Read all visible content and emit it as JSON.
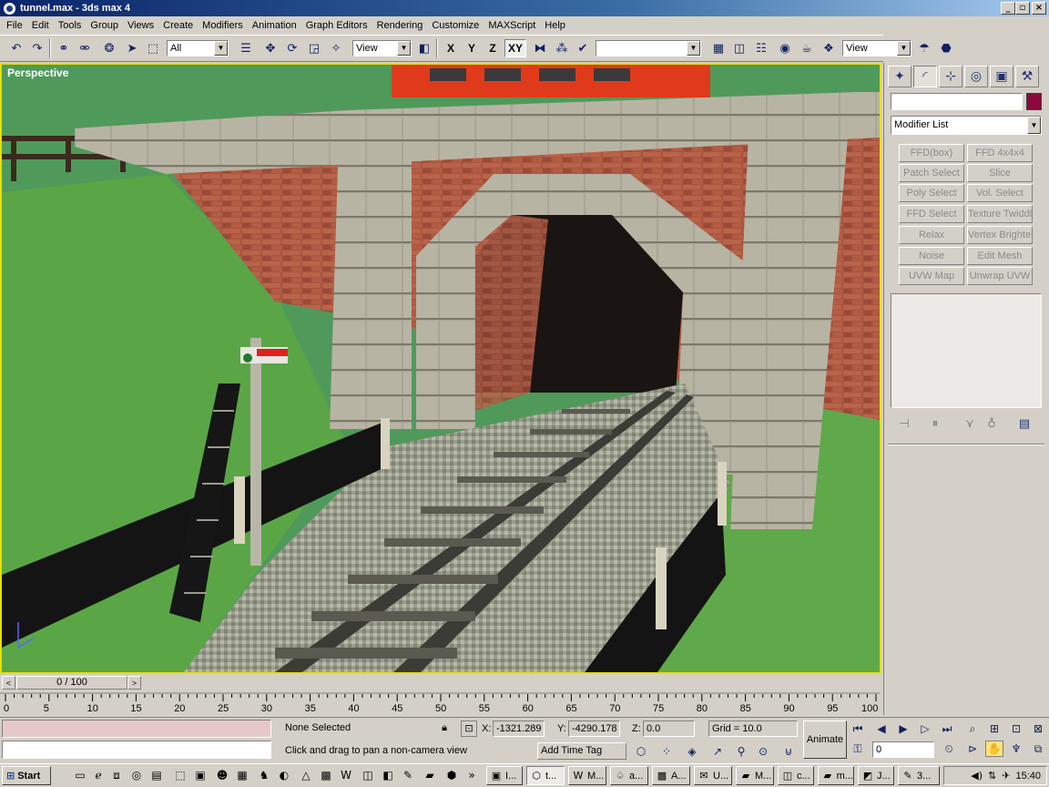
{
  "window": {
    "title": "tunnel.max - 3ds max 4",
    "min": "_",
    "max": "▫",
    "close": "×"
  },
  "menu": [
    "File",
    "Edit",
    "Tools",
    "Group",
    "Views",
    "Create",
    "Modifiers",
    "Animation",
    "Graph Editors",
    "Rendering",
    "Customize",
    "MAXScript",
    "Help"
  ],
  "toolbar": {
    "selection_filter": "All",
    "reference_coord": "View",
    "axis_x": "X",
    "axis_y": "Y",
    "axis_z": "Z",
    "axis_xy": "XY",
    "named_selection": "",
    "render_view": "View"
  },
  "viewport": {
    "label": "Perspective"
  },
  "panel": {
    "name_value": "",
    "object_color": "#8b0a3c",
    "modifier_list": "Modifier List",
    "buttons": [
      "FFD(box)",
      "FFD 4x4x4",
      "Patch Select",
      "Slice",
      "Poly Select",
      "Vol. Select",
      "FFD Select",
      "Texture Twiddle",
      "Relax",
      "Vertex Brightener",
      "Noise",
      "Edit Mesh",
      "UVW Map",
      "Unwrap UVW"
    ]
  },
  "timeline": {
    "slider": "0 / 100",
    "ticks": [
      "0",
      "5",
      "10",
      "15",
      "20",
      "25",
      "30",
      "35",
      "40",
      "45",
      "50",
      "55",
      "60",
      "65",
      "70",
      "75",
      "80",
      "85",
      "90",
      "95",
      "100"
    ]
  },
  "status": {
    "selection": "None Selected",
    "x_label": "X:",
    "x": "-1321.289",
    "y_label": "Y:",
    "y": "-4290.178",
    "z_label": "Z:",
    "z": "0.0",
    "grid": "Grid = 10.0",
    "prompt": "Click and drag to pan a non-camera view",
    "add_time_tag": "Add Time Tag",
    "animate": "Animate",
    "frame": "0"
  },
  "taskbar": {
    "start": "Start",
    "tasks": [
      "I...",
      "t...",
      "M...",
      "a...",
      "A...",
      "U...",
      "M...",
      "c...",
      "m...",
      "J...",
      "3..."
    ],
    "clock": "15:40"
  }
}
